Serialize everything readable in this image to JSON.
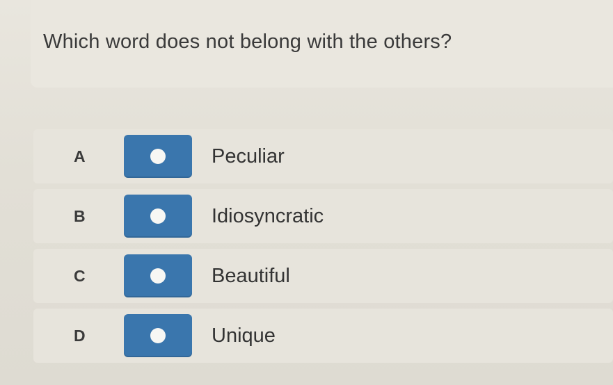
{
  "question": {
    "text": "Which word does not belong with the others?"
  },
  "options": [
    {
      "letter": "A",
      "label": "Peculiar"
    },
    {
      "letter": "B",
      "label": "Idiosyncratic"
    },
    {
      "letter": "C",
      "label": "Beautiful"
    },
    {
      "letter": "D",
      "label": "Unique"
    }
  ],
  "colors": {
    "radio_box": "#3a76ad",
    "radio_dot": "#f7f7f4",
    "background": "#e4e1d8"
  }
}
